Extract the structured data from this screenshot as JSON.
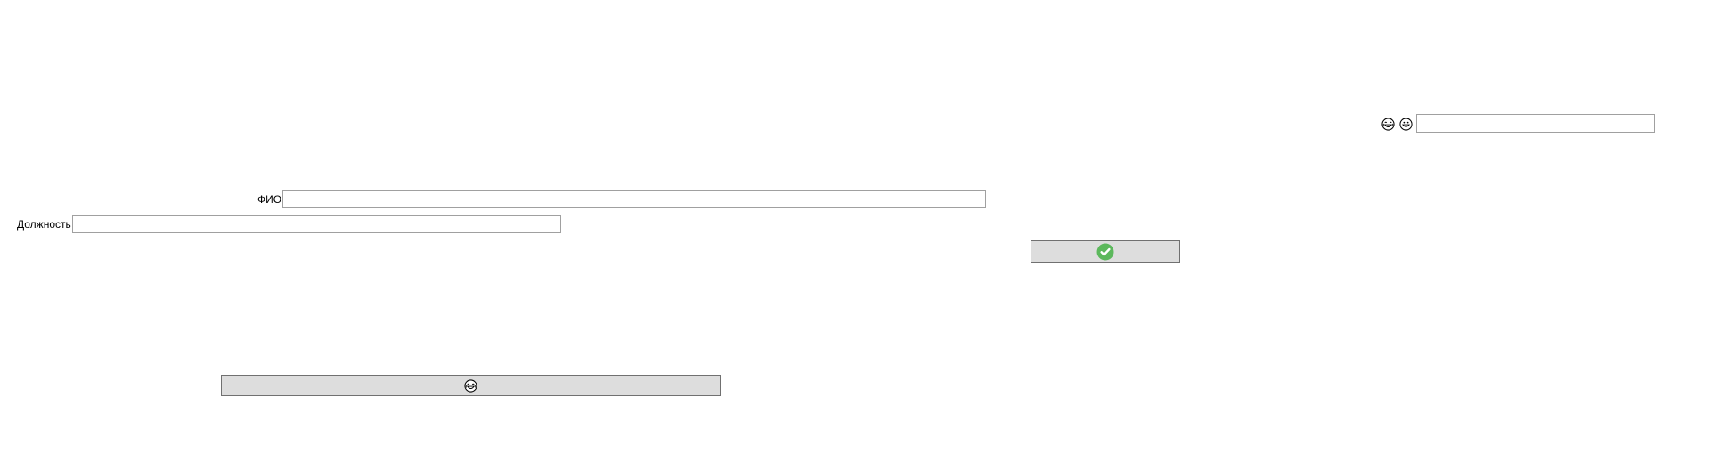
{
  "top_search": {
    "icons": [
      "grinning-tears-icon",
      "smiley-icon"
    ],
    "value": "",
    "placeholder": ""
  },
  "form": {
    "fio_label": "ФИО",
    "fio_value": "",
    "position_label": "Должность",
    "position_value": ""
  },
  "confirm_button": {
    "icon": "green-check-circle-icon",
    "accent_color": "#5cb85c"
  },
  "emoji_button": {
    "icon": "grinning-tears-icon"
  }
}
